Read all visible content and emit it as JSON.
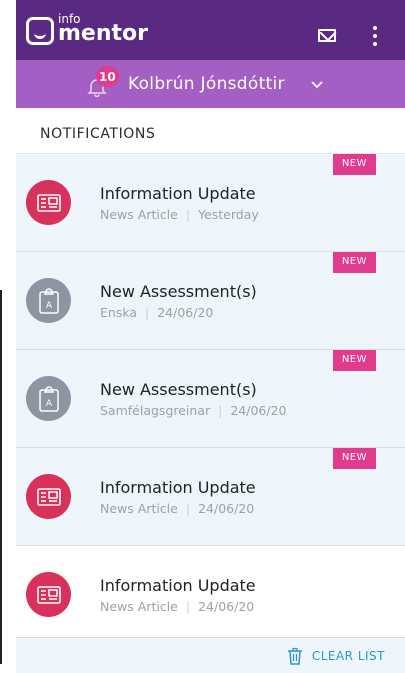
{
  "header": {
    "brand_small": "info",
    "brand_large": "mentor"
  },
  "userbar": {
    "notification_count": "10",
    "username": "Kolbrún Jónsdóttir"
  },
  "section": {
    "title": "NOTIFICATIONS"
  },
  "notifications": [
    {
      "title": "Information Update",
      "source": "News Article",
      "date": "Yesterday",
      "tag": "NEW",
      "icon": "newspaper-icon"
    },
    {
      "title": "New Assessment(s)",
      "source": "Enska",
      "date": "24/06/20",
      "tag": "NEW",
      "icon": "clipboard-icon"
    },
    {
      "title": "New Assessment(s)",
      "source": "Samfélagsgreinar",
      "date": "24/06/20",
      "tag": "NEW",
      "icon": "clipboard-icon"
    },
    {
      "title": "Information Update",
      "source": "News Article",
      "date": "24/06/20",
      "tag": "NEW",
      "icon": "newspaper-icon"
    },
    {
      "title": "Information Update",
      "source": "News Article",
      "date": "24/06/20",
      "tag": "",
      "icon": "newspaper-icon"
    }
  ],
  "footer": {
    "clear_label": "CLEAR LIST"
  },
  "colors": {
    "header": "#5a2a82",
    "userbar": "#a35fc4",
    "accent": "#e23a8d",
    "link": "#2e96c9",
    "news_icon_bg": "#d8315b",
    "assessment_icon_bg": "#8d96a0"
  }
}
